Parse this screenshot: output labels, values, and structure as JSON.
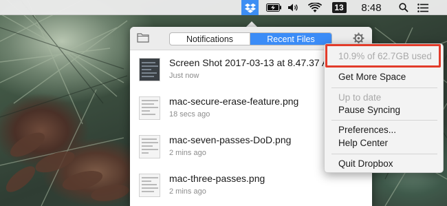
{
  "menubar": {
    "badge_text": "13",
    "time": "8:48",
    "icons": [
      "dropbox-icon",
      "battery-charging-icon",
      "volume-icon",
      "wifi-icon",
      "search-icon",
      "list-icon"
    ],
    "dropbox_highlight_color": "#3d8ef3"
  },
  "panel": {
    "tabs": [
      {
        "label": "Notifications",
        "active": false
      },
      {
        "label": "Recent Files",
        "active": true
      }
    ],
    "accent_color": "#3b8cf7",
    "files": [
      {
        "name": "Screen Shot 2017-03-13 at 8.47.37 AM.png",
        "time": "Just now"
      },
      {
        "name": "mac-secure-erase-feature.png",
        "time": "18 secs ago"
      },
      {
        "name": "mac-seven-passes-DoD.png",
        "time": "2 mins ago"
      },
      {
        "name": "mac-three-passes.png",
        "time": "2 mins ago"
      }
    ]
  },
  "menu": {
    "usage": "10.9% of 62.7GB used",
    "get_more_space": "Get More Space",
    "sync_status": "Up to date",
    "pause_syncing": "Pause Syncing",
    "preferences": "Preferences...",
    "help_center": "Help Center",
    "quit": "Quit Dropbox",
    "highlight_color": "#e23b2a"
  }
}
